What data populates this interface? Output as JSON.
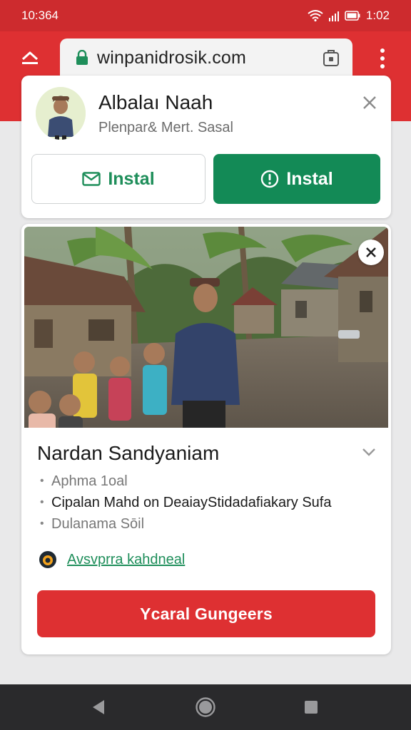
{
  "status_bar": {
    "time": "10:364",
    "clock": "1:02"
  },
  "browser": {
    "url": "winpanidrosik.com"
  },
  "install_card": {
    "app_name": "Albalaı Naah",
    "app_subtitle": "Plenpar& Mert. Sasal",
    "button_left_label": "Instal",
    "button_right_label": "Instal"
  },
  "ad_card": {
    "title": "Nardan Sandyaniam",
    "bullets": [
      "Aphma 1oal",
      "Cipalan Mahd on DeaiayStidadafiakary  Sufa",
      "Dulanama Sōil"
    ],
    "link_text": "Avsvprra kahdneal",
    "cta_label": "Ycaral Gungeers"
  },
  "colors": {
    "brand_red": "#de3032",
    "status_red": "#cd2b2e",
    "install_green": "#138a56",
    "link_green": "#1e8e5a"
  },
  "icons": [
    "menu-icon",
    "lock-icon",
    "tab-icon",
    "more-icon",
    "mail-icon",
    "info-icon",
    "close-icon",
    "chevron-down-icon",
    "ad-icon",
    "back-icon",
    "home-icon",
    "recents-icon",
    "wifi-icon",
    "signal-icon",
    "battery-icon"
  ]
}
